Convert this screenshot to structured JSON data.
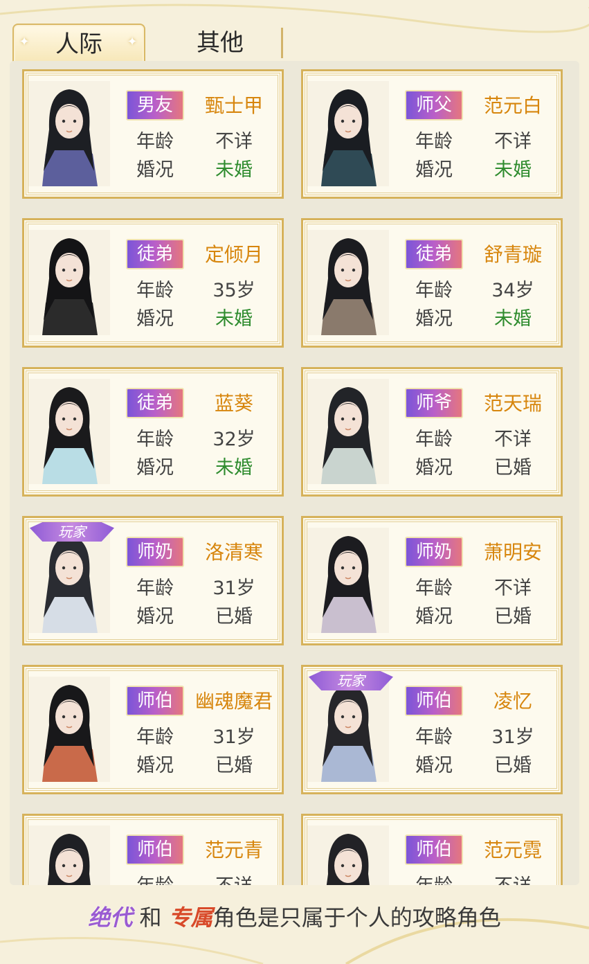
{
  "tabs": [
    {
      "label": "人际",
      "active": true
    },
    {
      "label": "其他",
      "active": false
    }
  ],
  "labels": {
    "age": "年龄",
    "marriage": "婚况"
  },
  "characters": [
    {
      "relation": "男友",
      "name": "甄士甲",
      "age": "不详",
      "marriage": "未婚",
      "player": false
    },
    {
      "relation": "师父",
      "name": "范元白",
      "age": "不详",
      "marriage": "未婚",
      "player": false
    },
    {
      "relation": "徒弟",
      "name": "定倾月",
      "age": "35岁",
      "marriage": "未婚",
      "player": false
    },
    {
      "relation": "徒弟",
      "name": "舒青璇",
      "age": "34岁",
      "marriage": "未婚",
      "player": false
    },
    {
      "relation": "徒弟",
      "name": "蓝葵",
      "age": "32岁",
      "marriage": "未婚",
      "player": false
    },
    {
      "relation": "师爷",
      "name": "范天瑞",
      "age": "不详",
      "marriage": "已婚",
      "player": false
    },
    {
      "relation": "师奶",
      "name": "洛清寒",
      "age": "31岁",
      "marriage": "已婚",
      "player": true
    },
    {
      "relation": "师奶",
      "name": "萧明安",
      "age": "不详",
      "marriage": "已婚",
      "player": false
    },
    {
      "relation": "师伯",
      "name": "幽魂魔君",
      "age": "31岁",
      "marriage": "已婚",
      "player": false
    },
    {
      "relation": "师伯",
      "name": "凌忆",
      "age": "31岁",
      "marriage": "已婚",
      "player": true
    },
    {
      "relation": "师伯",
      "name": "范元青",
      "age": "不详",
      "marriage": "",
      "player": false
    },
    {
      "relation": "师伯",
      "name": "范元霓",
      "age": "不详",
      "marriage": "",
      "player": false
    }
  ],
  "player_badge": "玩家",
  "footer": {
    "word1": "绝代",
    "joiner": "和",
    "word2": "专属",
    "rest": "角色是只属于个人的攻略角色"
  },
  "colors": {
    "married_unmarried": "#2f8c2f",
    "name": "#d7860e",
    "border": "#d6b25b"
  }
}
